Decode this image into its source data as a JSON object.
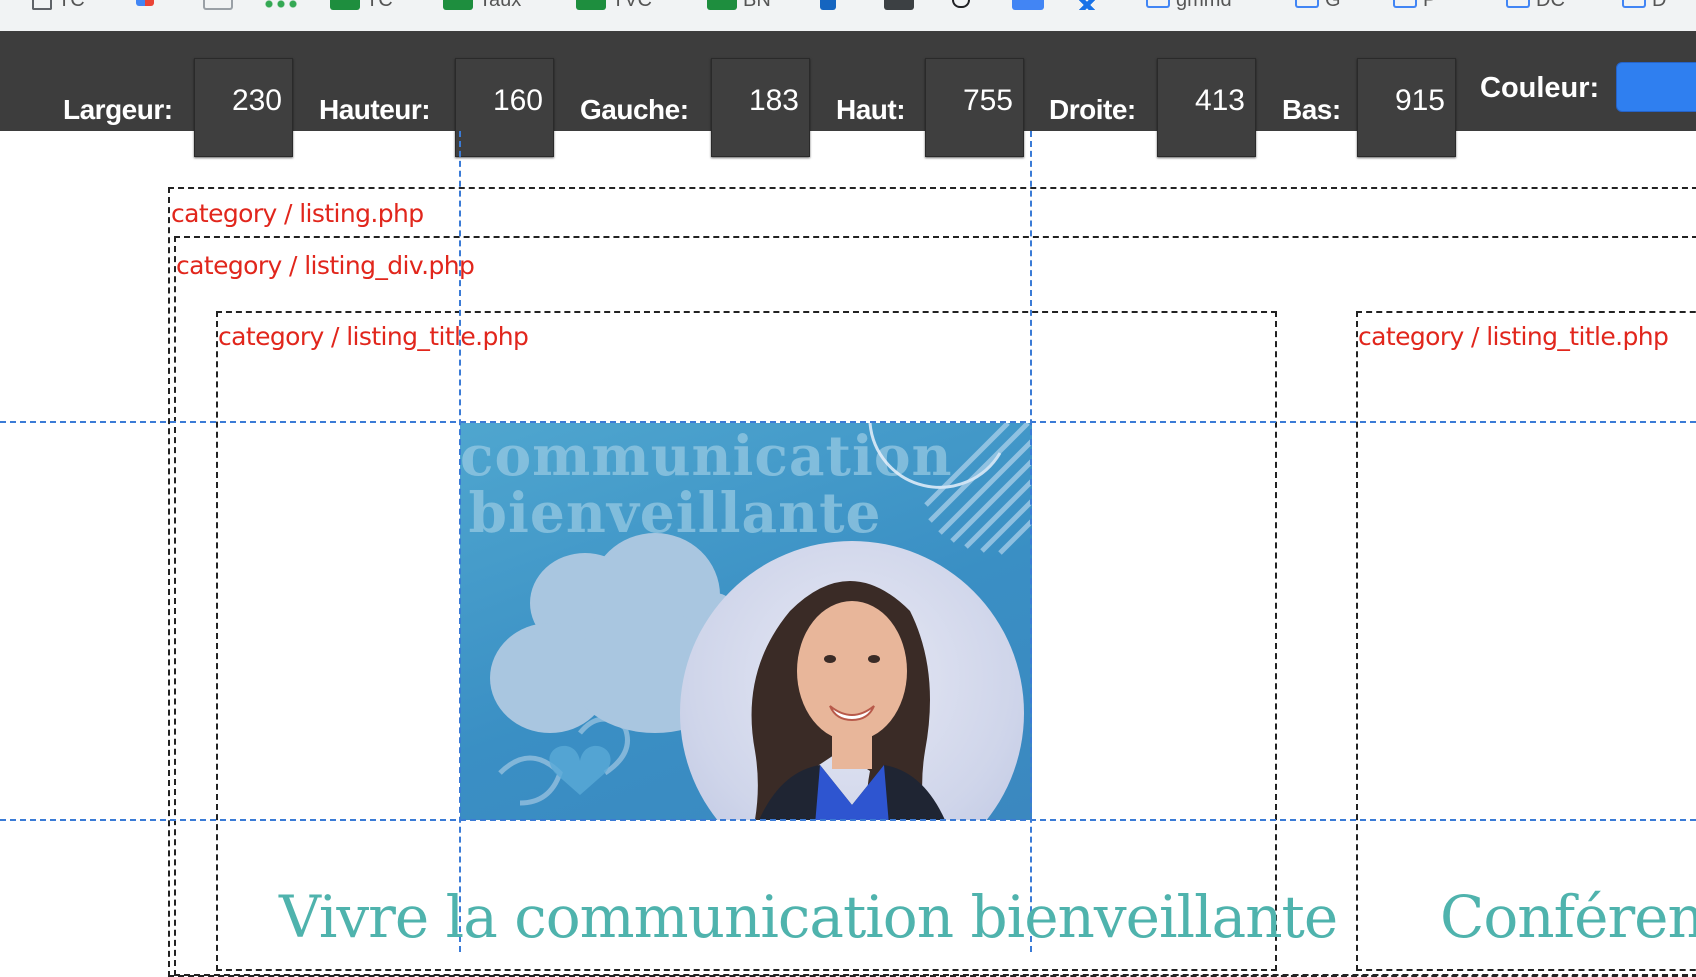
{
  "bookmarks": [
    {
      "label": "TC",
      "icon": "bookmark-page-icon",
      "color": "#5f6368"
    },
    {
      "label": "",
      "icon": "chart-icon",
      "color": "#4285f4"
    },
    {
      "label": "",
      "icon": "app-icon",
      "color": "#9aa0a6"
    },
    {
      "label": "",
      "icon": "network-icon",
      "color": "#34a853"
    },
    {
      "label": "TC",
      "icon": "sheets-icon",
      "color": "#1e8e3e"
    },
    {
      "label": "Taux",
      "icon": "sheets-icon",
      "color": "#1e8e3e"
    },
    {
      "label": "TVC",
      "icon": "sheets-icon",
      "color": "#1e8e3e"
    },
    {
      "label": "BN",
      "icon": "sheets-icon",
      "color": "#1e8e3e"
    },
    {
      "label": "",
      "icon": "outlook-icon",
      "color": "#1565c0"
    },
    {
      "label": "",
      "icon": "app-dark-icon",
      "color": "#3c4043"
    },
    {
      "label": "",
      "icon": "speech-icon",
      "color": "#202124"
    },
    {
      "label": "",
      "icon": "image-icon",
      "color": "#4285f4"
    },
    {
      "label": "",
      "icon": "x-icon",
      "color": "#1a73e8"
    },
    {
      "label": "gmmd",
      "icon": "folder-icon",
      "color": "#4285f4"
    },
    {
      "label": "G",
      "icon": "folder-icon",
      "color": "#4285f4"
    },
    {
      "label": "P",
      "icon": "folder-icon",
      "color": "#4285f4"
    },
    {
      "label": "DC",
      "icon": "folder-icon",
      "color": "#4285f4"
    },
    {
      "label": "D",
      "icon": "folder-icon",
      "color": "#4285f4"
    }
  ],
  "toolbar": {
    "fields": [
      {
        "label": "Largeur:",
        "value": "230"
      },
      {
        "label": "Hauteur:",
        "value": "160"
      },
      {
        "label": "Gauche:",
        "value": "183"
      },
      {
        "label": "Haut:",
        "value": "755"
      },
      {
        "label": "Droite:",
        "value": "413"
      },
      {
        "label": "Bas:",
        "value": "915"
      }
    ],
    "color_label": "Couleur:",
    "color_value": "#2f7ff0"
  },
  "page": {
    "debug_labels": {
      "listing": "category / listing.php",
      "listing_div": "category / listing_div.php",
      "listing_title_1": "category / listing_title.php",
      "listing_title_2": "category / listing_title.php"
    },
    "image": {
      "title_line_1": "communication",
      "title_line_2": "bienveillante"
    },
    "titles": {
      "item_1": "Vivre la communication bienveillante",
      "item_2": "Conféren"
    }
  },
  "colors": {
    "debug_label": "#e1261c",
    "guide": "#3b7bd6",
    "title": "#4fb3ad",
    "toolbar_bg": "#3d3d3d"
  }
}
